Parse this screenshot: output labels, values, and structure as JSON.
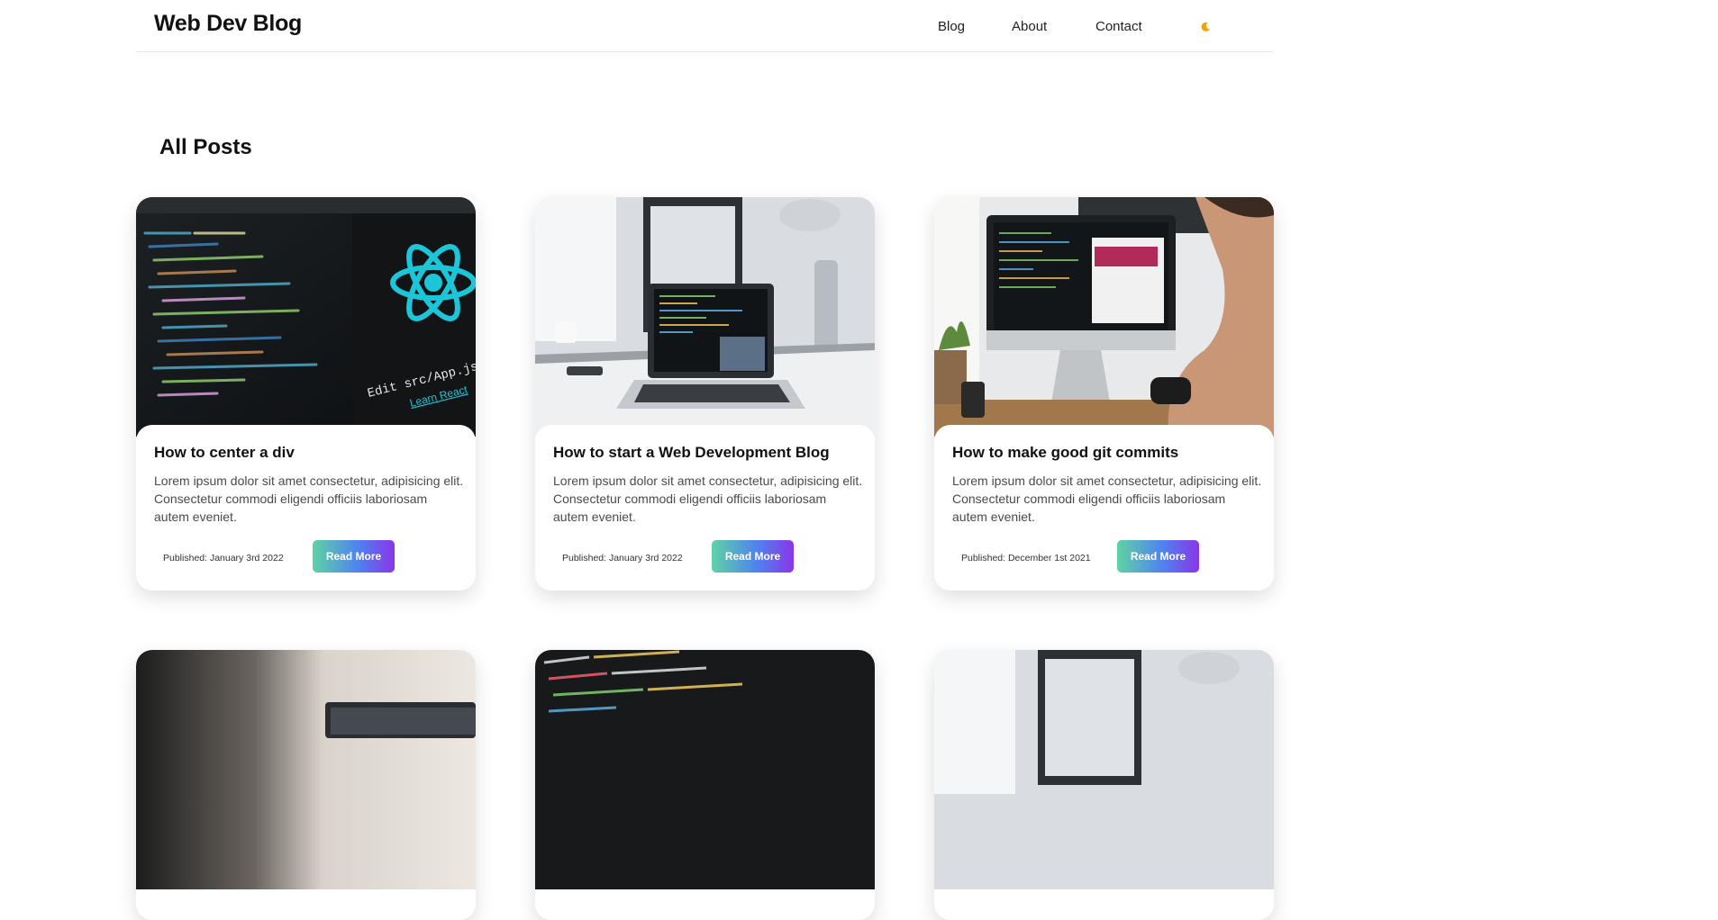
{
  "header": {
    "logo": "Web Dev Blog",
    "nav": [
      {
        "label": "Blog"
      },
      {
        "label": "About"
      },
      {
        "label": "Contact"
      }
    ],
    "theme_icon": "moon-icon",
    "theme_icon_color": "#f0a500"
  },
  "main": {
    "title": "All Posts",
    "posts": [
      {
        "title": "How to center a div",
        "excerpt": "Lorem ipsum dolor sit amet consectetur, adipisicing elit. Consectetur commodi eligendi officiis laboriosam autem eveniet.",
        "published": "Published: January 3rd 2022",
        "button": "Read More",
        "image": "react-code-screen-image"
      },
      {
        "title": "How to start a Web Development Blog",
        "excerpt": "Lorem ipsum dolor sit amet consectetur, adipisicing elit. Consectetur commodi eligendi officiis laboriosam autem eveniet.",
        "published": "Published: January 3rd 2022",
        "button": "Read More",
        "image": "laptop-on-desk-image"
      },
      {
        "title": "How to make good git commits",
        "excerpt": "Lorem ipsum dolor sit amet consectetur, adipisicing elit. Consectetur commodi eligendi officiis laboriosam autem eveniet.",
        "published": "Published: December 1st 2021",
        "button": "Read More",
        "image": "developer-at-imac-image"
      }
    ],
    "more_posts": [
      {
        "image": "laptop-wall-image"
      },
      {
        "image": "code-closeup-image"
      },
      {
        "image": "desk-setup-image"
      }
    ]
  },
  "colors": {
    "button_gradient": [
      "#5fd3a4",
      "#4f83f0",
      "#8a35e8"
    ]
  }
}
